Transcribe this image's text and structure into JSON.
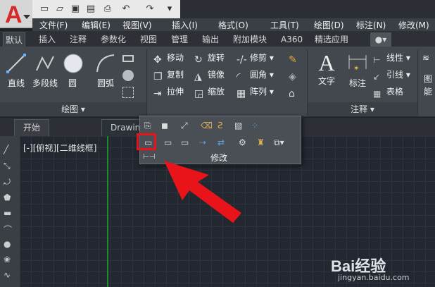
{
  "quick_access": {
    "icons": [
      "new-file-icon",
      "open-folder-icon",
      "save-icon",
      "save-as-icon",
      "print-icon",
      "undo-icon",
      "redo-icon",
      "customize-icon"
    ]
  },
  "menubar": {
    "items": [
      "文件(F)",
      "编辑(E)",
      "视图(V)",
      "插入(I)",
      "格式(O)",
      "工具(T)",
      "绘图(D)",
      "标注(N)",
      "修改(M)"
    ]
  },
  "ribbon_tabs": [
    "默认",
    "插入",
    "注释",
    "参数化",
    "视图",
    "管理",
    "输出",
    "附加模块",
    "A360",
    "精选应用"
  ],
  "draw_panel": {
    "title": "绘图",
    "big_buttons": [
      "直线",
      "多段线",
      "圆",
      "圆弧"
    ]
  },
  "modify_panel": {
    "rows": [
      [
        "移动",
        "旋转",
        "修剪"
      ],
      [
        "复制",
        "镜像",
        "圆角"
      ],
      [
        "拉伸",
        "缩放",
        "阵列"
      ]
    ]
  },
  "annotation_panel": {
    "title": "注释",
    "big_buttons": [
      "文字",
      "标注"
    ],
    "small": [
      "线性",
      "引线",
      "表格"
    ]
  },
  "right_partial": {
    "labels": [
      "图",
      "能"
    ]
  },
  "doc_tabs": [
    "开始",
    "Drawing"
  ],
  "viewport_label": "[-][俯视][二维线框]",
  "flyout": {
    "title": "修改"
  },
  "watermark": {
    "brand": "Bai经验",
    "url": "jingyan.baidu.com"
  },
  "colors": {
    "accent_red": "#e8141a",
    "ucs_green": "#1d8a2f",
    "ribbon_bg": "#43484f"
  }
}
